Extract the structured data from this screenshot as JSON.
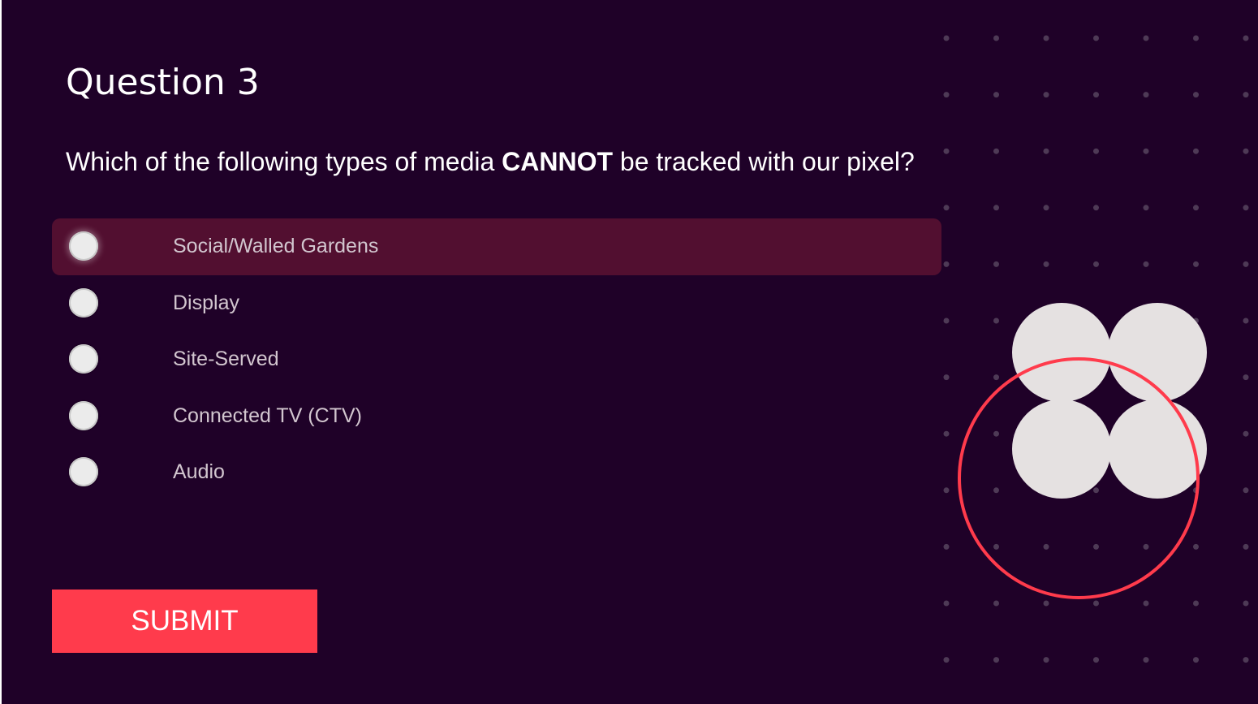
{
  "quiz": {
    "title": "Question 3",
    "prompt_before": "Which of the following types of media ",
    "prompt_emphasis": "CANNOT",
    "prompt_after": " be tracked with our pixel?",
    "options": [
      {
        "label": "Social/Walled Gardens",
        "selected": false,
        "hovered": true
      },
      {
        "label": "Display",
        "selected": false,
        "hovered": false
      },
      {
        "label": "Site-Served",
        "selected": false,
        "hovered": false
      },
      {
        "label": "Connected TV (CTV)",
        "selected": false,
        "hovered": false
      },
      {
        "label": "Audio",
        "selected": false,
        "hovered": false
      }
    ],
    "submit_label": "SUBMIT"
  },
  "colors": {
    "background": "#1f0128",
    "hover_row": "#520f30",
    "accent": "#ff3b4c",
    "option_text": "#d2c6cf",
    "graphic_circles": "#e5e1e1",
    "dot": "#4e3a56"
  },
  "decoration": {
    "dot_grid": {
      "rows": 12,
      "cols": 7
    },
    "circles": 4,
    "ring_color": "#ff3b4c"
  }
}
